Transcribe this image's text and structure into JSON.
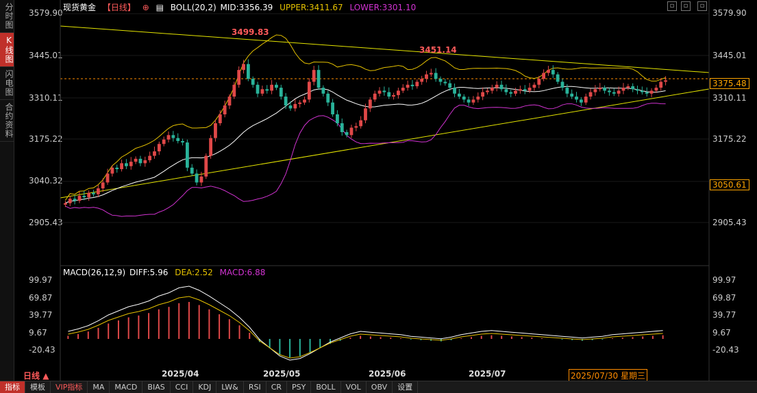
{
  "sidebar": [
    "分时图",
    "K线图",
    "闪电图",
    "合约资料"
  ],
  "header": {
    "instrument": "现货黄金",
    "period": "【日线】",
    "boll_label": "BOLL(20,2)",
    "mid": "MID:3356.39",
    "upper": "UPPER:3411.67",
    "lower": "LOWER:3301.10"
  },
  "y_axis_main": [
    "3579.90",
    "3445.01",
    "3310.11",
    "3175.22",
    "3040.32",
    "2905.43"
  ],
  "price_tags": {
    "current": "3375.48",
    "other": "3050.61"
  },
  "annotations": {
    "high1": "3499.83",
    "high2": "3451.14"
  },
  "macd_header": {
    "label": "MACD(26,12,9)",
    "diff": "DIFF:5.96",
    "dea": "DEA:2.52",
    "macd": "MACD:6.88"
  },
  "y_axis_macd": [
    "99.97",
    "69.87",
    "39.77",
    "9.67",
    "-20.43"
  ],
  "x_axis": [
    "2025/04",
    "2025/05",
    "2025/06",
    "2025/07"
  ],
  "cursor_date": "2025/07/30 星期三",
  "period_label": "日线",
  "bottom_tabs": [
    "指标",
    "模板",
    "VIP指标",
    "MA",
    "MACD",
    "BIAS",
    "CCI",
    "KDJ",
    "LW&",
    "RSI",
    "CR",
    "PSY",
    "BOLL",
    "VOL",
    "OBV",
    "设置"
  ],
  "chart_data": {
    "type": "candlestick",
    "ylim": [
      2860,
      3600
    ],
    "closes": [
      2960,
      2975,
      2968,
      2985,
      2980,
      2995,
      2990,
      3010,
      3030,
      3060,
      3080,
      3075,
      3095,
      3085,
      3100,
      3110,
      3095,
      3105,
      3120,
      3135,
      3160,
      3175,
      3190,
      3180,
      3170,
      3165,
      3080,
      3060,
      3030,
      3050,
      3120,
      3180,
      3230,
      3260,
      3290,
      3320,
      3360,
      3410,
      3430,
      3380,
      3360,
      3330,
      3345,
      3340,
      3360,
      3350,
      3320,
      3290,
      3280,
      3295,
      3300,
      3310,
      3370,
      3410,
      3350,
      3330,
      3300,
      3260,
      3230,
      3200,
      3190,
      3215,
      3220,
      3240,
      3280,
      3310,
      3330,
      3340,
      3335,
      3320,
      3325,
      3340,
      3350,
      3360,
      3355,
      3370,
      3380,
      3395,
      3400,
      3380,
      3370,
      3365,
      3350,
      3330,
      3320,
      3310,
      3300,
      3310,
      3320,
      3335,
      3340,
      3350,
      3360,
      3345,
      3335,
      3330,
      3340,
      3345,
      3340,
      3350,
      3360,
      3380,
      3400,
      3410,
      3395,
      3370,
      3350,
      3330,
      3320,
      3310,
      3300,
      3320,
      3335,
      3345,
      3350,
      3340,
      3335,
      3330,
      3340,
      3350,
      3355,
      3345,
      3340,
      3335,
      3330,
      3340,
      3350,
      3370,
      3375
    ],
    "macd_hist_sample": [
      5,
      8,
      12,
      18,
      25,
      30,
      35,
      38,
      42,
      48,
      52,
      58,
      60,
      55,
      48,
      40,
      32,
      22,
      10,
      -5,
      -15,
      -25,
      -30,
      -28,
      -22,
      -15,
      -8,
      -3,
      2,
      5,
      4,
      3,
      2,
      1,
      -1,
      -2,
      -3,
      -4,
      -2,
      1,
      3,
      5,
      6,
      5,
      4,
      3,
      2,
      1,
      0,
      -1,
      -2,
      -3,
      -2,
      -1,
      1,
      2,
      3,
      4,
      5,
      6
    ]
  }
}
